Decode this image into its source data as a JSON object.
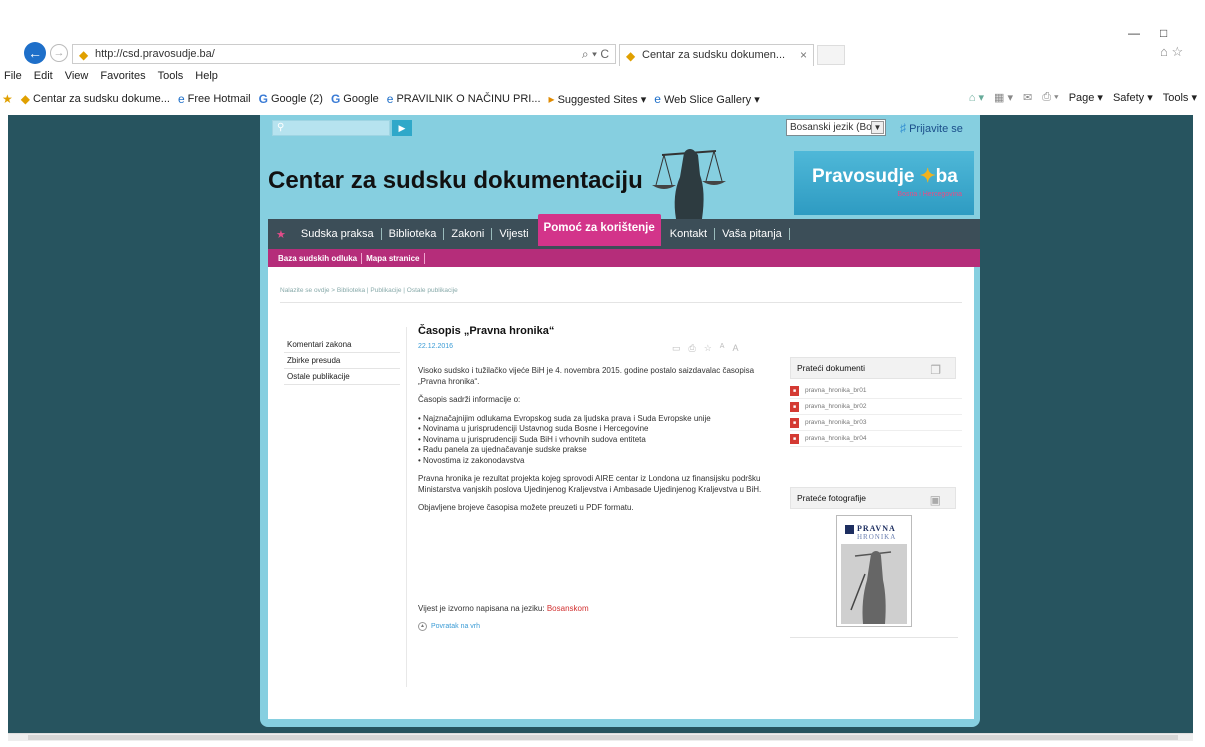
{
  "browser": {
    "url": "http://csd.pravosudje.ba/",
    "url_tools": "⌕ ▾ C",
    "tab_title": "Centar za sudsku dokumen...",
    "menu": [
      "File",
      "Edit",
      "View",
      "Favorites",
      "Tools",
      "Help"
    ],
    "favorites": [
      {
        "icon": "◆",
        "label": "Centar za sudsku dokume..."
      },
      {
        "icon": "e",
        "label": "Free Hotmail"
      },
      {
        "icon": "G",
        "label": "Google (2)"
      },
      {
        "icon": "G",
        "label": "Google"
      },
      {
        "icon": "e",
        "label": "PRAVILNIK O NAČINU PRI..."
      },
      {
        "icon": "▸",
        "label": "Suggested Sites ▾"
      },
      {
        "icon": "e",
        "label": "Web Slice Gallery ▾"
      }
    ],
    "commands": [
      "Page ▾",
      "Safety ▾",
      "Tools ▾"
    ]
  },
  "site": {
    "language": "Bosanski jezik (Bos)",
    "login": "Prijavite se",
    "title": "Centar za sudsku dokumentaciju",
    "brand_name_a": "Pravosudje",
    "brand_name_b": "ba",
    "brand_sub": "Bosna i Hercegovina",
    "nav": [
      "Sudska praksa",
      "Biblioteka",
      "Zakoni",
      "Vijesti",
      "Pomoć za korištenje",
      "Kontakt",
      "Vaša pitanja"
    ],
    "subnav": [
      "Baza sudskih odluka",
      "Mapa stranice"
    ],
    "breadcrumb": "Nalazite se ovdje > Biblioteka | Publikacije | Ostale publikacije",
    "side_links": [
      "Komentari zakona",
      "Zbirke presuda",
      "Ostale publikacije"
    ]
  },
  "article": {
    "title": "Časopis „Pravna hronika“",
    "date": "22.12.2016",
    "tools": [
      "▭",
      "⎙",
      "☆",
      "A",
      "A"
    ],
    "p1": "Visoko sudsko i tužilačko vijeće BiH je 4. novembra 2015. godine postalo saizdavalac časopisa „Pravna hronika“.",
    "p2": "Časopis sadrži informacije o:",
    "bullets": [
      "• Najznačajnijim odlukama Evropskog suda za ljudska prava i Suda Evropske unije",
      "• Novinama u jurisprudenciji Ustavnog suda Bosne i Hercegovine",
      "• Novinama u jurisprudenciji Suda BiH i vrhovnih sudova entiteta",
      "• Radu panela za ujednačavanje sudske prakse",
      "• Novostima iz zakonodavstva"
    ],
    "p3": "Pravna hronika je rezultat projekta kojeg sprovodi AIRE centar iz Londona uz finansijsku podršku Ministarstva vanjskih poslova Ujedinjenog Kraljevstva i Ambasade Ujedinjenog Kraljevstva u BiH.",
    "p4": "Objavljene brojeve časopisa možete preuzeti u PDF formatu.",
    "lang_prefix": "Vijest je izvorno napisana na jeziku:",
    "lang_link": "Bosanskom",
    "back_to_top": "Povratak na vrh"
  },
  "sidebar": {
    "docs_title": "Prateći dokumenti",
    "docs": [
      "pravna_hronika_br01",
      "pravna_hronika_br02",
      "pravna_hronika_br03",
      "pravna_hronika_br04"
    ],
    "photos_title": "Prateće fotografije",
    "magazine_line1": "PRAVNA",
    "magazine_line2": "HRONIKA"
  }
}
